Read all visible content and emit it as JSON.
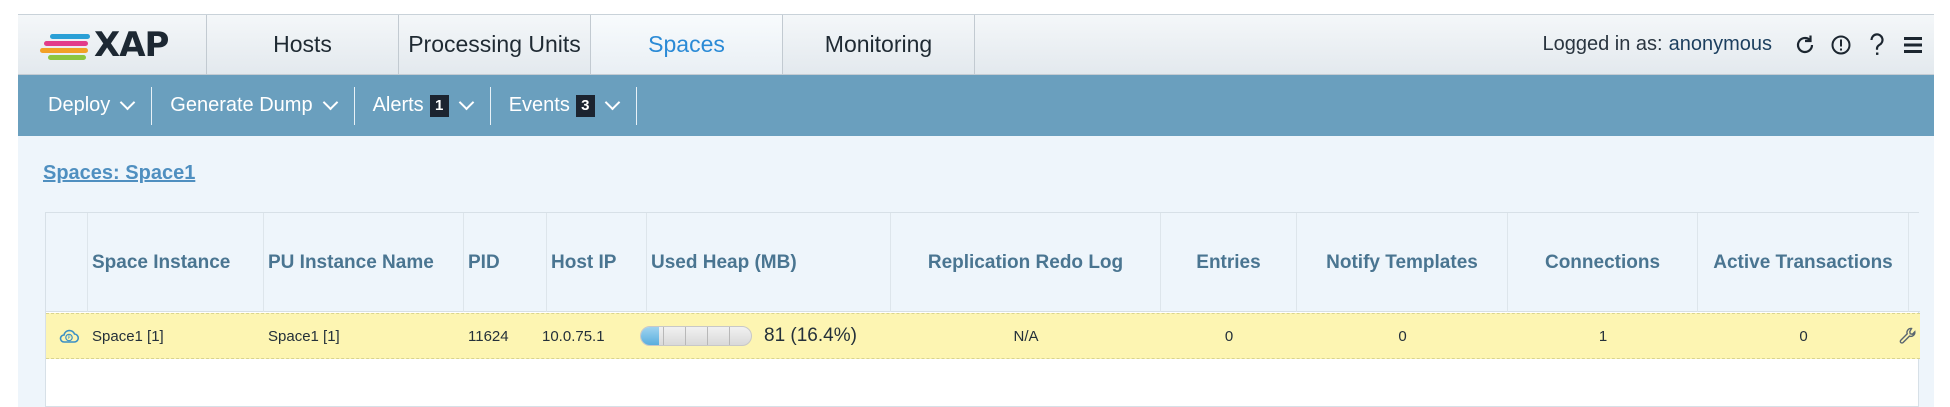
{
  "app": {
    "logo_text": "XAP"
  },
  "nav": {
    "tabs": [
      {
        "label": "Hosts",
        "active": false
      },
      {
        "label": "Processing Units",
        "active": false
      },
      {
        "label": "Spaces",
        "active": true
      },
      {
        "label": "Monitoring",
        "active": false
      }
    ],
    "login_prefix": "Logged in as:",
    "login_user": "anonymous",
    "icons": [
      "refresh-icon",
      "alert-circle-icon",
      "help-icon",
      "menu-icon"
    ]
  },
  "actions": [
    {
      "label": "Deploy"
    },
    {
      "label": "Generate Dump"
    },
    {
      "label": "Alerts",
      "badge": "1"
    },
    {
      "label": "Events",
      "badge": "3"
    }
  ],
  "breadcrumb": "Spaces: Space1",
  "table": {
    "columns": [
      "",
      "Space Instance",
      "PU Instance Name",
      "PID",
      "Host IP",
      "Used Heap (MB)",
      "Replication Redo Log",
      "Entries",
      "Notify Templates",
      "Connections",
      "Active Transactions",
      ""
    ],
    "rows": [
      {
        "space_instance": "Space1 [1]",
        "pu_instance_name": "Space1 [1]",
        "pid": "11624",
        "host_ip": "10.0.75.1",
        "used_heap_text": "81 (16.4%)",
        "used_heap_fraction": 0.164,
        "replication_redo_log": "N/A",
        "entries": "0",
        "notify_templates": "0",
        "connections": "1",
        "active_transactions": "0"
      }
    ]
  },
  "colors": {
    "accent": "#2a8ad6",
    "actionbar": "#6a9fbe",
    "row_highlight": "#fdf5b2",
    "header_text": "#4a7591"
  }
}
